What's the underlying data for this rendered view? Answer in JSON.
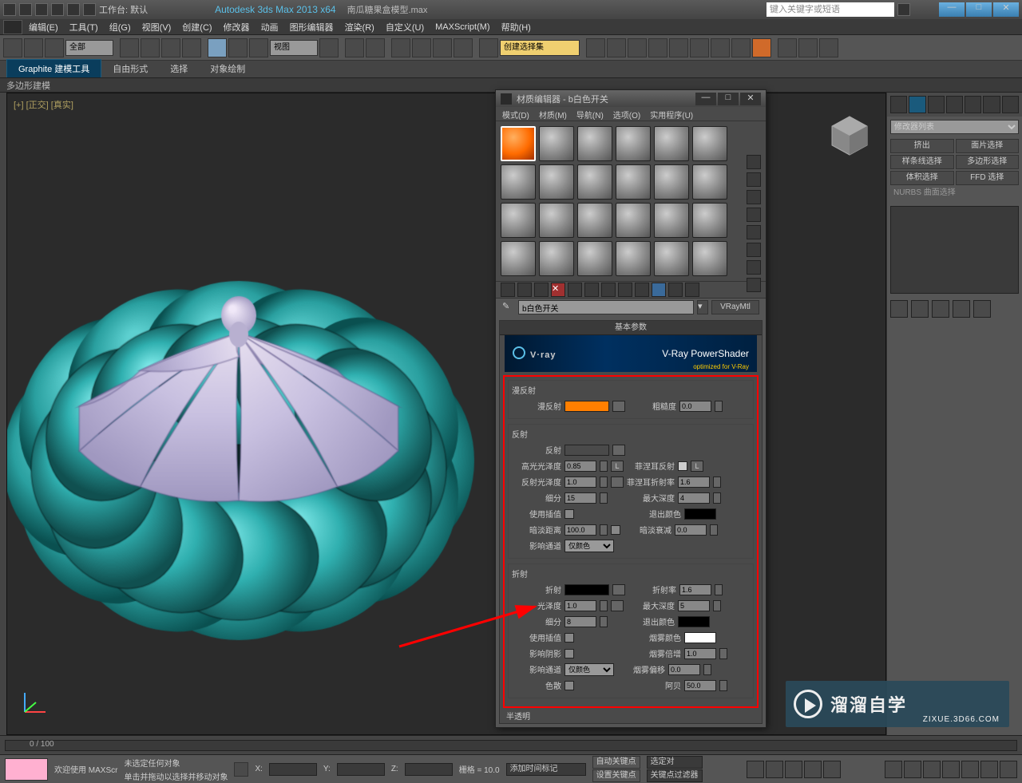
{
  "title": {
    "app": "Autodesk 3ds Max  2013 x64",
    "doc": "南瓜糖果盒模型.max",
    "workspace_label": "工作台: 默认",
    "search_placeholder": "键入关键字或短语"
  },
  "menu": [
    "编辑(E)",
    "工具(T)",
    "组(G)",
    "视图(V)",
    "创建(C)",
    "修改器",
    "动画",
    "图形编辑器",
    "渲染(R)",
    "自定义(U)",
    "MAXScript(M)",
    "帮助(H)"
  ],
  "toolbar": {
    "filter": "全部",
    "view_dd": "视图",
    "set_dd": "创建选择集"
  },
  "tabs": {
    "items": [
      "Graphite 建模工具",
      "自由形式",
      "选择",
      "对象绘制"
    ],
    "sub": "多边形建模"
  },
  "viewport": {
    "label": "[+] [正交] [真实]"
  },
  "rpanel": {
    "modlist_label": "修改器列表",
    "buttons": [
      "挤出",
      "面片选择",
      "样条线选择",
      "多边形选择",
      "体积选择",
      "FFD 选择"
    ],
    "nurbs": "NURBS 曲面选择"
  },
  "mateditor": {
    "title": "材质编辑器 - b白色开关",
    "menu": [
      "模式(D)",
      "材质(M)",
      "导航(N)",
      "选项(O)",
      "实用程序(U)"
    ],
    "mat_name": "b白色开关",
    "mat_type": "VRayMtl",
    "rollout": "基本参数",
    "vray_brand": "V·ray",
    "vray_ps": "V-Ray PowerShader",
    "vray_sub": "optimized for V-Ray",
    "diffuse": {
      "title": "漫反射",
      "label": "漫反射",
      "color": "#ff7f00",
      "rough_label": "粗糙度",
      "rough_val": "0.0"
    },
    "reflect": {
      "title": "反射",
      "label": "反射",
      "color": "#4a4a4a",
      "hgloss_label": "高光光泽度",
      "hgloss_val": "0.85",
      "rgloss_label": "反射光泽度",
      "rgloss_val": "1.0",
      "subdiv_label": "细分",
      "subdiv_val": "15",
      "interp_label": "使用插值",
      "dimdist_label": "暗淡距离",
      "dimdist_val": "100.0",
      "affect_label": "影响通道",
      "affect_val": "仅颜色",
      "fresnel_label": "菲涅耳反射",
      "fior_label": "菲涅耳折射率",
      "fior_val": "1.6",
      "maxd_label": "最大深度",
      "maxd_val": "4",
      "exit_label": "退出颜色",
      "dimfall_label": "暗淡衰减",
      "dimfall_val": "0.0",
      "L": "L"
    },
    "refract": {
      "title": "折射",
      "label": "折射",
      "color": "#000000",
      "gloss_label": "光泽度",
      "gloss_val": "1.0",
      "subdiv_label": "细分",
      "subdiv_val": "8",
      "interp_label": "使用插值",
      "shadow_label": "影响阴影",
      "affect_label": "影响通道",
      "affect_val": "仅颜色",
      "disp_label": "色散",
      "ior_label": "折射率",
      "ior_val": "1.6",
      "maxd_label": "最大深度",
      "maxd_val": "5",
      "exit_label": "退出颜色",
      "fog_label": "烟雾颜色",
      "fog_color": "#ffffff",
      "fogm_label": "烟雾倍增",
      "fogm_val": "1.0",
      "fogb_label": "烟雾偏移",
      "fogb_val": "0.0",
      "abbe_label": "阿贝",
      "abbe_val": "50.0"
    },
    "semi": "半透明"
  },
  "status": {
    "welcome": "欢迎使用  MAXScr",
    "none_sel": "未选定任何对象",
    "drag_hint": "单击并拖动以选择并移动对象",
    "x": "X:",
    "y": "Y:",
    "z": "Z:",
    "grid": "栅格 = 10.0",
    "addtime": "添加时间标记",
    "autokey": "自动关键点",
    "setkey": "设置关键点",
    "selset": "选定对",
    "keyfilter": "关键点过滤器"
  },
  "timeline": {
    "range": "0 / 100"
  },
  "watermark": {
    "brand": "溜溜自学",
    "url": "ZIXUE.3D66.COM"
  }
}
